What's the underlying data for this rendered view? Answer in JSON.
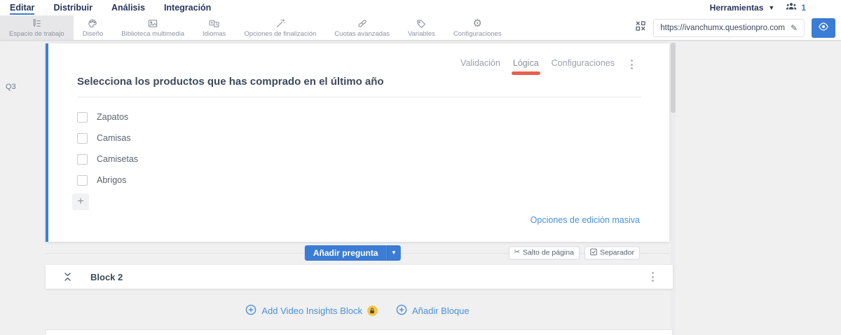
{
  "colors": {
    "accent_blue": "#3b7cd5",
    "link_blue": "#4a90d9",
    "navy": "#25355c",
    "tab_red": "#e8604c",
    "badge_yellow": "#f4c64d"
  },
  "top_nav": {
    "items": [
      {
        "label": "Editar"
      },
      {
        "label": "Distribuir"
      },
      {
        "label": "Análisis"
      },
      {
        "label": "Integración"
      }
    ],
    "tools_label": "Herramientas",
    "collaborators_count": "1"
  },
  "toolbar": {
    "tabs": [
      {
        "label": "Espacio de trabajo"
      },
      {
        "label": "Diseño"
      },
      {
        "label": "Biblioteca multimedia"
      },
      {
        "label": "Idiomas"
      },
      {
        "label": "Opciones de finalización"
      },
      {
        "label": "Cuotas avanzadas"
      },
      {
        "label": "Variables"
      },
      {
        "label": "Configuraciones"
      }
    ],
    "url": "https://ivanchumx.questionpro.com"
  },
  "question": {
    "id_label": "Q3",
    "tabs": [
      {
        "label": "Validación"
      },
      {
        "label": "Lógica"
      },
      {
        "label": "Configuraciones"
      }
    ],
    "title": "Selecciona los productos que has comprado en el último año",
    "options": [
      {
        "label": "Zapatos"
      },
      {
        "label": "Camisas"
      },
      {
        "label": "Camisetas"
      },
      {
        "label": "Abrigos"
      }
    ],
    "add_option_label": "+",
    "bulk_edit_label": "Opciones de edición masiva"
  },
  "question_actions": {
    "add_question_label": "Añadir pregunta",
    "page_break_label": "Salto de página",
    "separator_label": "Separador"
  },
  "block": {
    "title": "Block 2"
  },
  "footer": {
    "add_video_label": "Add Video Insights Block",
    "add_block_label": "Añadir Bloque"
  }
}
